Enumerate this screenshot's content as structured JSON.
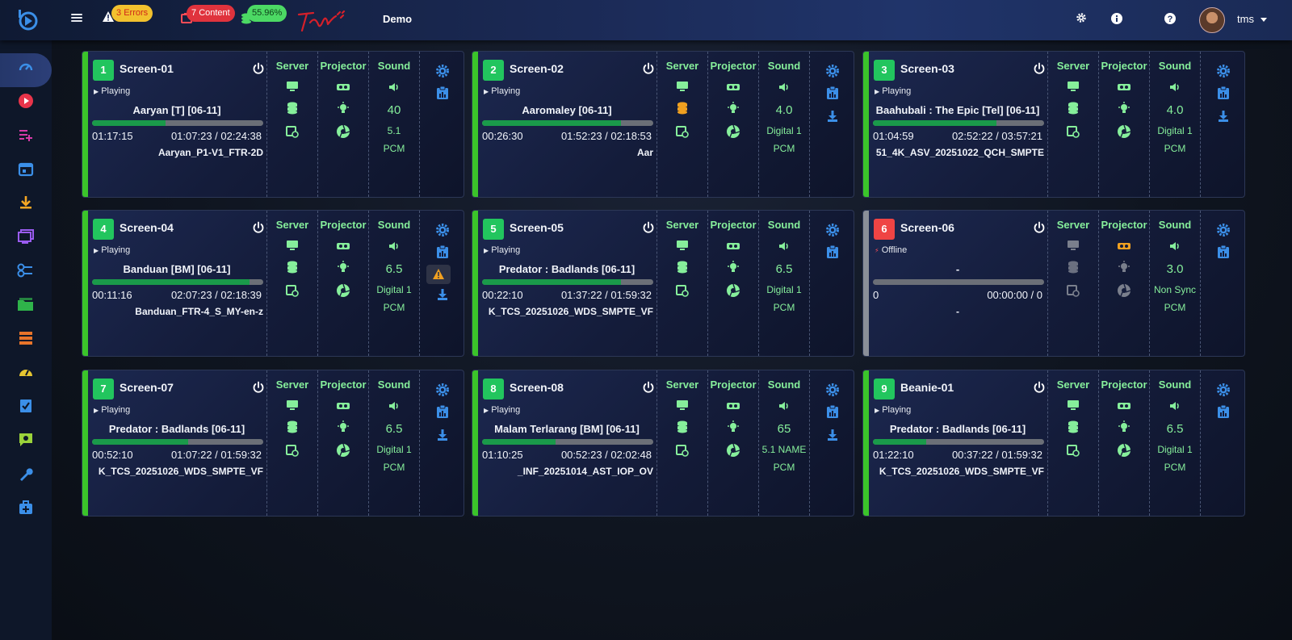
{
  "topbar": {
    "errors_count": "3",
    "errors_label": "Errors",
    "content_count": "7",
    "content_label": "Content",
    "percent": "55.96%",
    "site_name": "Demo",
    "user_name": "tms"
  },
  "columns": {
    "server": "Server",
    "projector": "Projector",
    "sound": "Sound"
  },
  "screens": [
    {
      "num": "1",
      "name": "Screen-01",
      "status": "Playing",
      "title": "Aaryan [T] [06-11]",
      "progress": 0.43,
      "elapsed": "01:17:15",
      "time": "01:07:23 / 02:24:38",
      "file": "Aaryan_P1-V1_FTR-2D",
      "sound_main": "40",
      "sound_fmt": "5.1",
      "sound_pcm": "PCM",
      "server_db_color": "#86ef9b",
      "extra_action": ""
    },
    {
      "num": "2",
      "name": "Screen-02",
      "status": "Playing",
      "title": "Aaromaley [06-11]",
      "progress": 0.81,
      "elapsed": "00:26:30",
      "time": "01:52:23 / 02:18:53",
      "file": "Aar",
      "sound_main": "4.0",
      "sound_fmt": "Digital 1",
      "sound_pcm": "PCM",
      "server_db_color": "#f0a020",
      "extra_action": "download"
    },
    {
      "num": "3",
      "name": "Screen-03",
      "status": "Playing",
      "title": "Baahubali : The Epic [Tel] [06-11]",
      "progress": 0.72,
      "elapsed": "01:04:59",
      "time": "02:52:22 / 03:57:21",
      "file": "51_4K_ASV_20251022_QCH_SMPTE",
      "sound_main": "4.0",
      "sound_fmt": "Digital 1",
      "sound_pcm": "PCM",
      "server_db_color": "#86ef9b",
      "extra_action": "download"
    },
    {
      "num": "4",
      "name": "Screen-04",
      "status": "Playing",
      "title": "Banduan [BM] [06-11]",
      "progress": 0.92,
      "elapsed": "00:11:16",
      "time": "02:07:23 / 02:18:39",
      "file": "Banduan_FTR-4_S_MY-en-z",
      "sound_main": "6.5",
      "sound_fmt": "Digital 1",
      "sound_pcm": "PCM",
      "server_db_color": "#86ef9b",
      "extra_action": "warning-download"
    },
    {
      "num": "5",
      "name": "Screen-05",
      "status": "Playing",
      "title": "Predator : Badlands [06-11]",
      "progress": 0.81,
      "elapsed": "00:22:10",
      "time": "01:37:22 / 01:59:32",
      "file": "K_TCS_20251026_WDS_SMPTE_VF",
      "sound_main": "6.5",
      "sound_fmt": "Digital 1",
      "sound_pcm": "PCM",
      "server_db_color": "#86ef9b",
      "extra_action": ""
    },
    {
      "num": "6",
      "name": "Screen-06",
      "status": "Offline",
      "title": "-",
      "progress": 0,
      "elapsed": "0",
      "time": "00:00:00 / 0",
      "file": "-",
      "sound_main": "3.0",
      "sound_fmt": "Non Sync",
      "sound_pcm": "PCM",
      "server_db_color": "#6b7080",
      "extra_action": ""
    },
    {
      "num": "7",
      "name": "Screen-07",
      "status": "Playing",
      "title": "Predator : Badlands [06-11]",
      "progress": 0.56,
      "elapsed": "00:52:10",
      "time": "01:07:22 / 01:59:32",
      "file": "K_TCS_20251026_WDS_SMPTE_VF",
      "sound_main": "6.5",
      "sound_fmt": "Digital 1",
      "sound_pcm": "PCM",
      "server_db_color": "#86ef9b",
      "extra_action": "download"
    },
    {
      "num": "8",
      "name": "Screen-08",
      "status": "Playing",
      "title": "Malam Terlarang [BM] [06-11]",
      "progress": 0.43,
      "elapsed": "01:10:25",
      "time": "00:52:23 / 02:02:48",
      "file": "_INF_20251014_AST_IOP_OV",
      "sound_main": "65",
      "sound_fmt": "5.1 NAME",
      "sound_pcm": "PCM",
      "server_db_color": "#86ef9b",
      "extra_action": "download"
    },
    {
      "num": "9",
      "name": "Beanie-01",
      "status": "Playing",
      "title": "Predator : Badlands [06-11]",
      "progress": 0.31,
      "elapsed": "01:22:10",
      "time": "00:37:22 / 01:59:32",
      "file": "K_TCS_20251026_WDS_SMPTE_VF",
      "sound_main": "6.5",
      "sound_fmt": "Digital 1",
      "sound_pcm": "PCM",
      "server_db_color": "#86ef9b",
      "extra_action": ""
    }
  ],
  "colors": {
    "accent_green": "#86ef9b",
    "ok_green": "#22c55e",
    "error_red": "#ef4444",
    "action_blue": "#3b8fe8",
    "warning_orange": "#f0a020"
  },
  "icons": {
    "sidebar": [
      "dashboard-icon",
      "play-icon",
      "playlist-add-icon",
      "calendar-icon",
      "download-icon",
      "monitor-icon",
      "keys-icon",
      "folder-icon",
      "server-icon",
      "gauge-icon",
      "checklist-icon",
      "settings-message-icon",
      "wrench-icon",
      "medical-kit-icon"
    ]
  }
}
